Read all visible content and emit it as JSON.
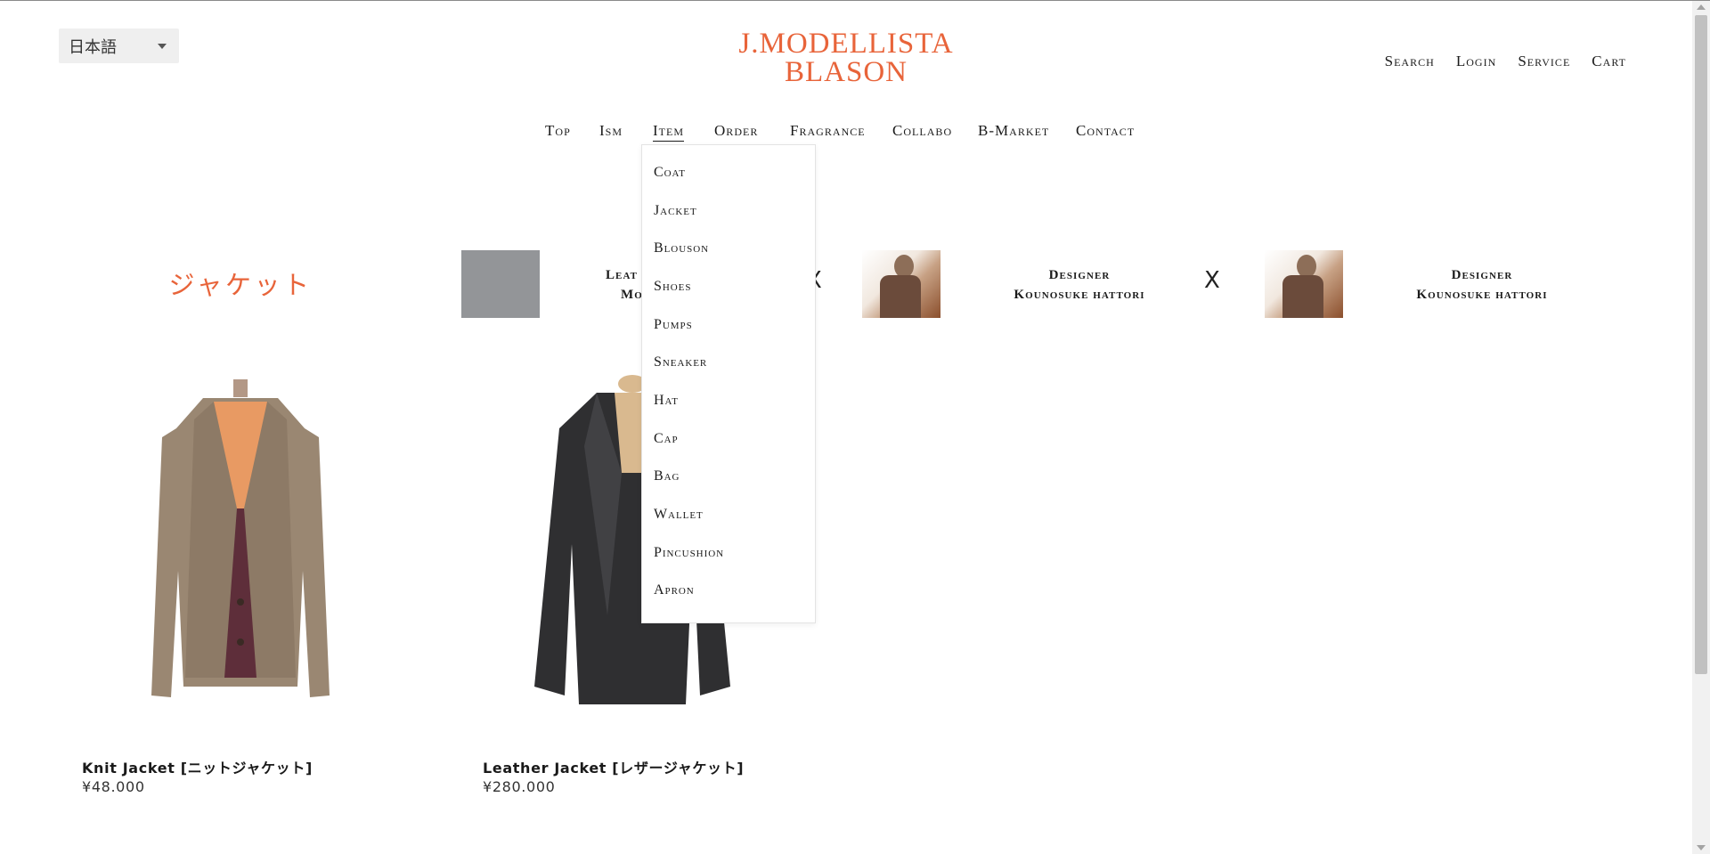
{
  "language": {
    "selected": "日本語"
  },
  "logo": {
    "line1": "J.MODELLISTA",
    "line2": "BLASON"
  },
  "utility_nav": [
    "Search",
    "Login",
    "Service",
    "Cart"
  ],
  "main_nav": [
    "Top",
    "Ism",
    "Item",
    "Order",
    "Fragrance",
    "Collabo",
    "B-Market",
    "Contact"
  ],
  "active_nav": "Item",
  "item_menu": [
    "Coat",
    "Jacket",
    "Blouson",
    "Shoes",
    "Pumps",
    "Sneaker",
    "Hat",
    "Cap",
    "Bag",
    "Wallet",
    "Pincushion",
    "Apron"
  ],
  "category_title": "ジャケット",
  "collab": [
    {
      "line1": "Leat",
      "line2": "Mo"
    },
    {
      "line1": "Designer",
      "line2": "Kounosuke hattori"
    },
    {
      "line1": "Designer",
      "line2": "Kounosuke hattori"
    }
  ],
  "separator": "X",
  "products": [
    {
      "name": "Knit Jacket [ニットジャケット]",
      "price": "¥48.000"
    },
    {
      "name": "Leather Jacket [レザージャケット]",
      "price": "¥280.000"
    }
  ],
  "colors": {
    "brand": "#e8643a",
    "placeholder": "#939598"
  }
}
